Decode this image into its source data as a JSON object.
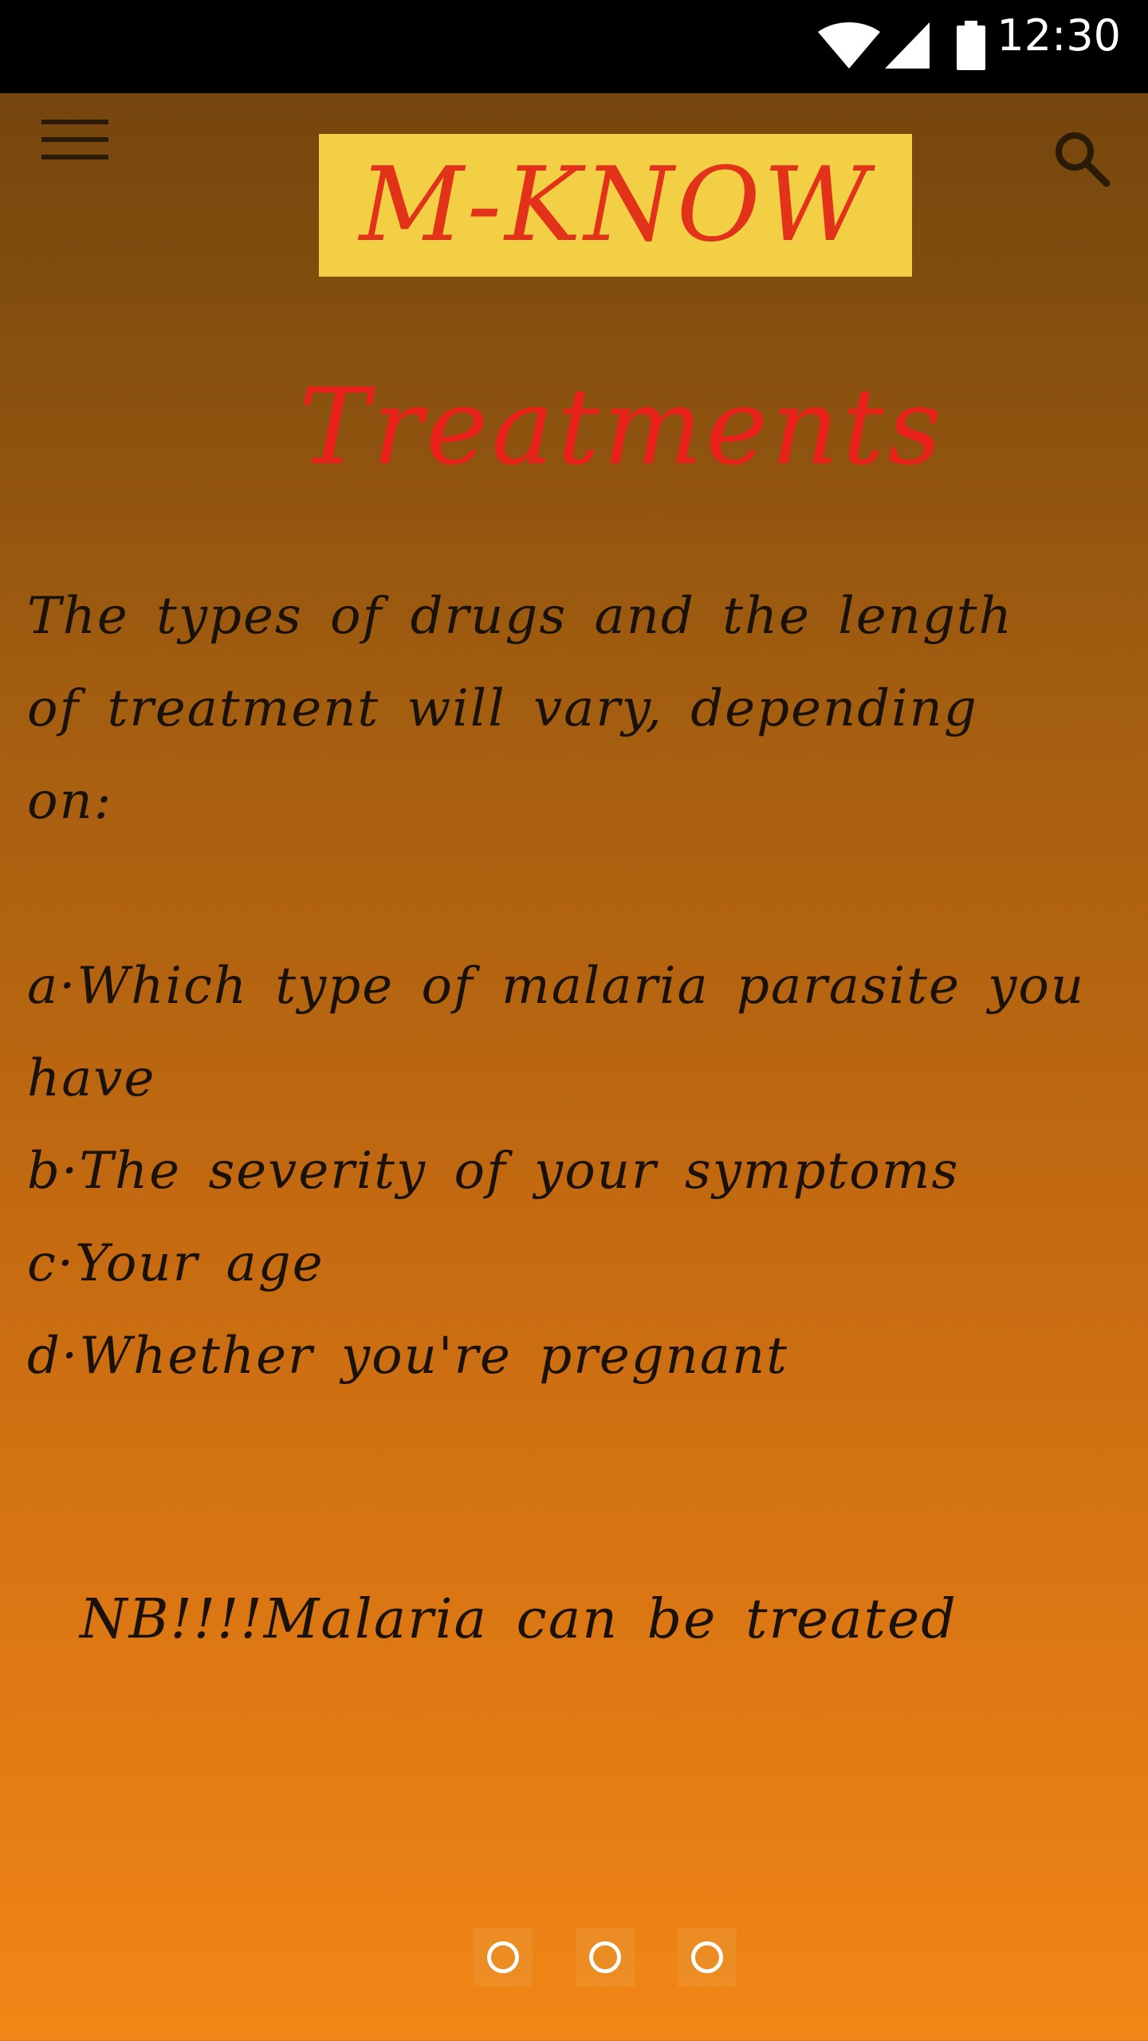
{
  "status_bar": {
    "time": "12:30",
    "icons": [
      "wifi-icon",
      "signal-icon",
      "battery-icon"
    ]
  },
  "app_bar": {
    "logo": "M-KNOW",
    "menu_icon": "menu-icon",
    "search_icon": "search-icon"
  },
  "page": {
    "title": "Treatments",
    "intro": "The types of drugs and the length of treatment will vary, depending on:",
    "items": [
      "a·Which type of malaria parasite you have",
      "b·The severity of your symptoms",
      "c·Your age",
      "d·Whether you're pregnant"
    ],
    "note": "NB!!!!Malaria can be treated"
  },
  "pager": {
    "count": 3
  },
  "colors": {
    "status_bar": "#000000",
    "logo_bg": "#f2cf45",
    "logo_text": "#e2321a",
    "title": "#e8221a",
    "body_text": "#1a1208",
    "gradient_top": "#6f420d",
    "gradient_bottom": "#f28616"
  }
}
